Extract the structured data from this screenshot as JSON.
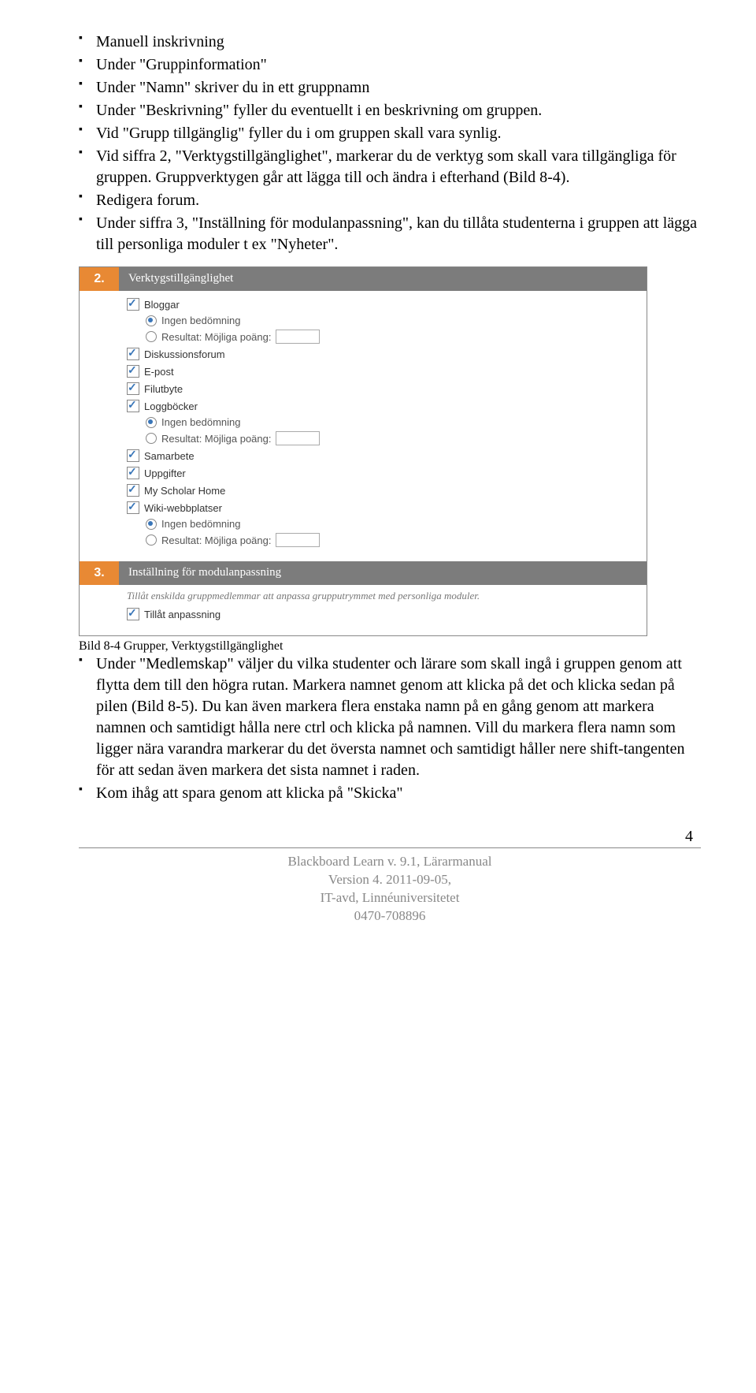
{
  "bullets_top": [
    "Manuell inskrivning",
    "Under \"Gruppinformation\"",
    "Under \"Namn\" skriver du in ett gruppnamn",
    "Under \"Beskrivning\" fyller du eventuellt i en beskrivning om gruppen.",
    "Vid \"Grupp tillgänglig\" fyller du i om gruppen skall vara synlig.",
    "Vid siffra 2, \"Verktygstillgänglighet\", markerar du de verktyg som skall vara tillgängliga för gruppen. Gruppverktygen går att lägga till och ändra i efterhand (Bild 8-4).",
    "Redigera forum.",
    "Under siffra 3, \"Inställning för modulanpassning\", kan du tillåta studenterna i gruppen att lägga till personliga moduler t ex \"Nyheter\"."
  ],
  "section2": {
    "num": "2.",
    "title": "Verktygstillgänglighet",
    "tools": [
      {
        "label": "Bloggar",
        "checked": true,
        "radios": [
          {
            "label": "Ingen bedömning",
            "selected": true,
            "has_input": false
          },
          {
            "label": "Resultat: Möjliga poäng:",
            "selected": false,
            "has_input": true
          }
        ]
      },
      {
        "label": "Diskussionsforum",
        "checked": true
      },
      {
        "label": "E-post",
        "checked": true
      },
      {
        "label": "Filutbyte",
        "checked": true
      },
      {
        "label": "Loggböcker",
        "checked": true,
        "radios": [
          {
            "label": "Ingen bedömning",
            "selected": true,
            "has_input": false
          },
          {
            "label": "Resultat: Möjliga poäng:",
            "selected": false,
            "has_input": true
          }
        ]
      },
      {
        "label": "Samarbete",
        "checked": true
      },
      {
        "label": "Uppgifter",
        "checked": true
      },
      {
        "label": "My Scholar Home",
        "checked": true
      },
      {
        "label": "Wiki-webbplatser",
        "checked": true,
        "radios": [
          {
            "label": "Ingen bedömning",
            "selected": true,
            "has_input": false
          },
          {
            "label": "Resultat: Möjliga poäng:",
            "selected": false,
            "has_input": true
          }
        ]
      }
    ]
  },
  "section3": {
    "num": "3.",
    "title": "Inställning för modulanpassning",
    "desc": "Tillåt enskilda gruppmedlemmar att anpassa grupputrymmet med personliga moduler.",
    "option_label": "Tillåt anpassning",
    "option_checked": true
  },
  "fig_caption": "Bild 8-4 Grupper, Verktygstillgänglighet",
  "bullets_bottom": [
    "Under \"Medlemskap\" väljer du vilka studenter och lärare som skall ingå i gruppen genom att flytta dem till den högra rutan. Markera namnet genom att klicka på det och klicka sedan på pilen (Bild 8-5). Du kan även markera flera enstaka namn på en gång genom att markera namnen och samtidigt hålla nere ctrl och klicka på namnen. Vill du markera flera namn som ligger nära varandra markerar du det översta namnet och samtidigt håller nere shift-tangenten för att sedan även markera det sista namnet i raden.",
    "Kom ihåg att spara genom att klicka på \"Skicka\""
  ],
  "footer": {
    "page": "4",
    "lines": [
      "Blackboard Learn v. 9.1, Lärarmanual",
      "Version 4. 2011-09-05,",
      "IT-avd, Linnéuniversitetet",
      "0470-708896"
    ]
  }
}
